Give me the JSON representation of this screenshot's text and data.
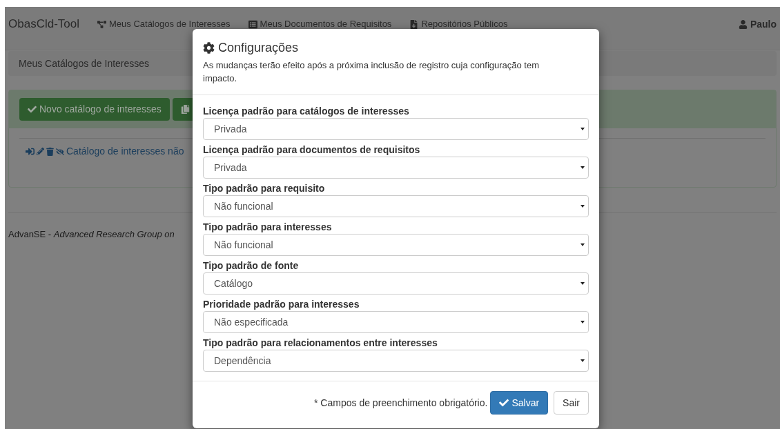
{
  "navbar": {
    "brand": "ObasCld-Tool",
    "items": [
      {
        "label": "Meus Catálogos de Interesses"
      },
      {
        "label": "Meus Documentos de Requisitos"
      },
      {
        "label": "Repositórios Públicos"
      }
    ],
    "user": "Paulo"
  },
  "breadcrumb": "Meus Catálogos de Interesses",
  "panel": {
    "new_button": "Novo catálogo de interesses",
    "row_link": "Catálogo de interesses não"
  },
  "footer": {
    "org": "AdvanSE",
    "separator": "-",
    "description": "Advanced Research Group on"
  },
  "modal": {
    "title": "Configurações",
    "description": "As mudanças terão efeito após a próxima inclusão de registro cuja configuração tem impacto.",
    "fields": [
      {
        "label": "Licença padrão para catálogos de interesses",
        "value": "Privada"
      },
      {
        "label": "Licença padrão para documentos de requisitos",
        "value": "Privada"
      },
      {
        "label": "Tipo padrão para requisito",
        "value": "Não funcional"
      },
      {
        "label": "Tipo padrão para interesses",
        "value": "Não funcional"
      },
      {
        "label": "Tipo padrão de fonte",
        "value": "Catálogo"
      },
      {
        "label": "Prioridade padrão para interesses",
        "value": "Não especificada"
      },
      {
        "label": "Tipo padrão para relacionamentos entre interesses",
        "value": "Dependência"
      }
    ],
    "required_note": "* Campos de preenchimento obrigatório.",
    "save_button": "Salvar",
    "exit_button": "Sair"
  }
}
